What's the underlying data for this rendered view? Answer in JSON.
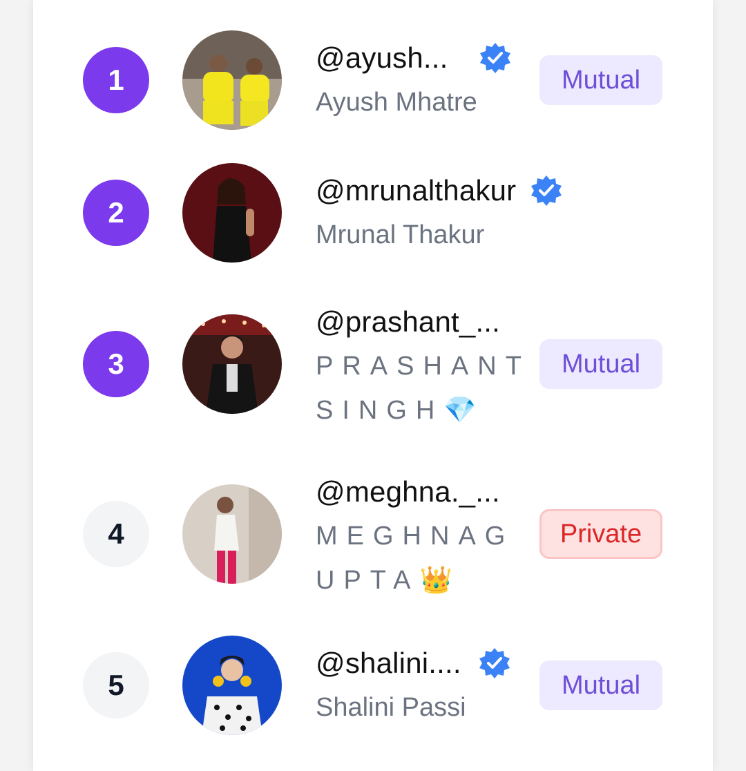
{
  "colors": {
    "rank_accent": "#7c3aed",
    "verified": "#3b82f6",
    "mutual_bg": "#ede9fe",
    "mutual_text": "#6d4fd8",
    "private_bg": "#fee2e2",
    "private_text": "#dc2626"
  },
  "users": [
    {
      "rank": "1",
      "handle": "@ayush...",
      "name": "Ayush Mhatre",
      "verified": true,
      "badge": "Mutual",
      "avatar_icon": "avatar-photo-icon"
    },
    {
      "rank": "2",
      "handle": "@mrunalthakur",
      "name": "Mrunal Thakur",
      "verified": true,
      "badge": "",
      "avatar_icon": "avatar-photo-icon"
    },
    {
      "rank": "3",
      "handle": "@prashant_...",
      "name_line1": "PRASHANT",
      "name_line2": "SINGH💎",
      "verified": false,
      "badge": "Mutual",
      "avatar_icon": "avatar-photo-icon"
    },
    {
      "rank": "4",
      "handle": "@meghna._...",
      "name_line1": "MEGHNAG",
      "name_line2": "UPTA👑",
      "verified": false,
      "badge": "Private",
      "avatar_icon": "avatar-photo-icon"
    },
    {
      "rank": "5",
      "handle": "@shalini....",
      "name": "Shalini Passi",
      "verified": true,
      "badge": "Mutual",
      "avatar_icon": "avatar-photo-icon"
    }
  ]
}
